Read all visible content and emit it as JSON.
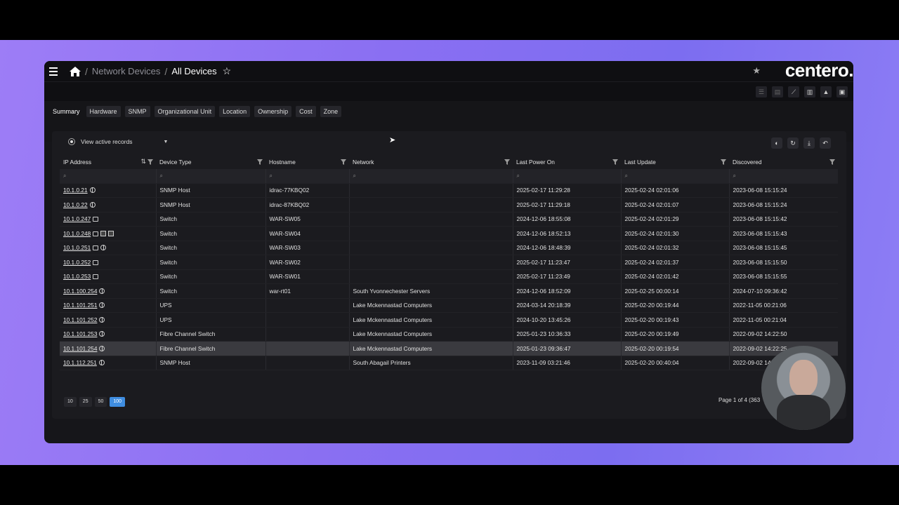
{
  "breadcrumb": {
    "parent": "Network Devices",
    "current": "All Devices",
    "separator": "/"
  },
  "brand": {
    "logo_text": "centero."
  },
  "tabs": [
    "Summary",
    "Hardware",
    "SNMP",
    "Organizational Unit",
    "Location",
    "Ownership",
    "Cost",
    "Zone"
  ],
  "view_selector": {
    "label": "View active records"
  },
  "columns": [
    "IP Address",
    "Device Type",
    "Hostname",
    "Network",
    "Last Power On",
    "Last Update",
    "Discovered"
  ],
  "rows": [
    {
      "ip": "10.1.0.21",
      "type": "SNMP Host",
      "host": "idrac-77KBQ02",
      "network": "",
      "power": "2025-02-17 11:29:28",
      "update": "2025-02-24 02:01:06",
      "discovered": "2023-06-08 15:15:24"
    },
    {
      "ip": "10.1.0.22",
      "type": "SNMP Host",
      "host": "idrac-87KBQ02",
      "network": "",
      "power": "2025-02-17 11:29:18",
      "update": "2025-02-24 02:01:07",
      "discovered": "2023-06-08 15:15:24"
    },
    {
      "ip": "10.1.0.247",
      "type": "Switch",
      "host": "WAR-SW05",
      "network": "",
      "power": "2024-12-06 18:55:08",
      "update": "2025-02-24 02:01:29",
      "discovered": "2023-06-08 15:15:42"
    },
    {
      "ip": "10.1.0.248",
      "type": "Switch",
      "host": "WAR-SW04",
      "network": "",
      "power": "2024-12-06 18:52:13",
      "update": "2025-02-24 02:01:30",
      "discovered": "2023-06-08 15:15:43"
    },
    {
      "ip": "10.1.0.251",
      "type": "Switch",
      "host": "WAR-SW03",
      "network": "",
      "power": "2024-12-06 18:48:39",
      "update": "2025-02-24 02:01:32",
      "discovered": "2023-06-08 15:15:45"
    },
    {
      "ip": "10.1.0.252",
      "type": "Switch",
      "host": "WAR-SW02",
      "network": "",
      "power": "2025-02-17 11:23:47",
      "update": "2025-02-24 02:01:37",
      "discovered": "2023-06-08 15:15:50"
    },
    {
      "ip": "10.1.0.253",
      "type": "Switch",
      "host": "WAR-SW01",
      "network": "",
      "power": "2025-02-17 11:23:49",
      "update": "2025-02-24 02:01:42",
      "discovered": "2023-06-08 15:15:55"
    },
    {
      "ip": "10.1.100.254",
      "type": "Switch",
      "host": "war-rt01",
      "network": "South Yvonnechester Servers",
      "power": "2024-12-06 18:52:09",
      "update": "2025-02-25 00:00:14",
      "discovered": "2024-07-10 09:36:42"
    },
    {
      "ip": "10.1.101.251",
      "type": "UPS",
      "host": "",
      "network": "Lake Mckennastad Computers",
      "power": "2024-03-14 20:18:39",
      "update": "2025-02-20 00:19:44",
      "discovered": "2022-11-05 00:21:06"
    },
    {
      "ip": "10.1.101.252",
      "type": "UPS",
      "host": "",
      "network": "Lake Mckennastad Computers",
      "power": "2024-10-20 13:45:26",
      "update": "2025-02-20 00:19:43",
      "discovered": "2022-11-05 00:21:04"
    },
    {
      "ip": "10.1.101.253",
      "type": "Fibre Channel Switch",
      "host": "",
      "network": "Lake Mckennastad Computers",
      "power": "2025-01-23 10:36:33",
      "update": "2025-02-20 00:19:49",
      "discovered": "2022-09-02 14:22:50"
    },
    {
      "ip": "10.1.101.254",
      "type": "Fibre Channel Switch",
      "host": "",
      "network": "Lake Mckennastad Computers",
      "power": "2025-01-23 09:36:47",
      "update": "2025-02-20 00:19:54",
      "discovered": "2022-09-02 14:22:25"
    },
    {
      "ip": "10.1.112.251",
      "type": "SNMP Host",
      "host": "",
      "network": "South Abagail Printers",
      "power": "2023-11-09 03:21:46",
      "update": "2025-02-20 00:40:04",
      "discovered": "2022-09-02 14"
    }
  ],
  "row_icons": [
    [
      "globe-icon"
    ],
    [
      "globe-icon"
    ],
    [
      "monitor-icon"
    ],
    [
      "monitor-icon",
      "document-icon",
      "document-icon"
    ],
    [
      "monitor-icon",
      "globe-icon"
    ],
    [
      "monitor-icon"
    ],
    [
      "monitor-icon"
    ],
    [
      "globe-icon"
    ],
    [
      "globe-icon"
    ],
    [
      "globe-icon"
    ],
    [
      "globe-icon"
    ],
    [
      "globe-icon"
    ],
    [
      "globe-icon"
    ]
  ],
  "page_sizes": [
    "10",
    "25",
    "50",
    "100"
  ],
  "active_page_size": "100",
  "page_info": "Page 1 of 4 (363",
  "colors": {
    "accent": "#3f8de0",
    "background": "#16161a"
  }
}
